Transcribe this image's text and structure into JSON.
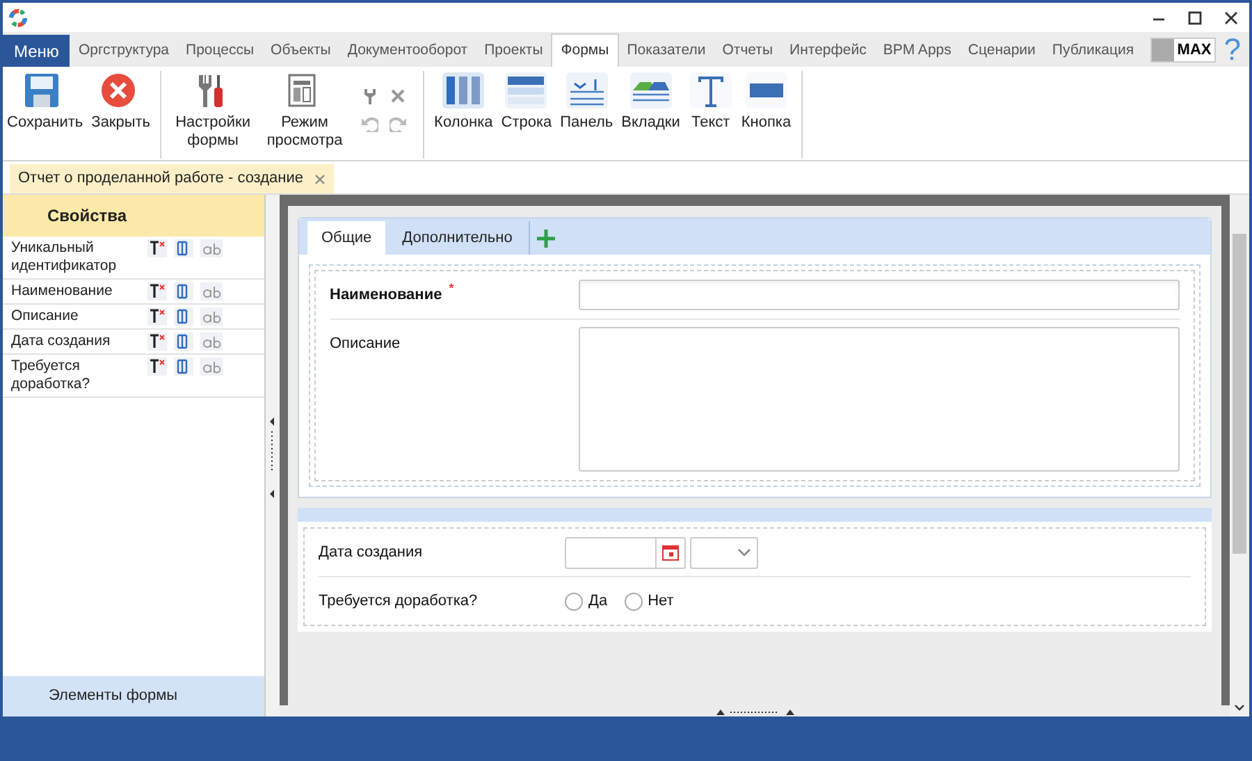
{
  "menu_button": "Меню",
  "tabs": [
    {
      "label": "Оргструктура",
      "selected": false
    },
    {
      "label": "Процессы",
      "selected": false
    },
    {
      "label": "Объекты",
      "selected": false
    },
    {
      "label": "Документооборот",
      "selected": false
    },
    {
      "label": "Проекты",
      "selected": false
    },
    {
      "label": "Формы",
      "selected": true
    },
    {
      "label": "Показатели",
      "selected": false
    },
    {
      "label": "Отчеты",
      "selected": false
    },
    {
      "label": "Интерфейс",
      "selected": false
    },
    {
      "label": "BPM Apps",
      "selected": false
    },
    {
      "label": "Сценарии",
      "selected": false
    },
    {
      "label": "Публикация",
      "selected": false
    }
  ],
  "mode_toggle": "MAX",
  "help": "?",
  "ribbon": [
    {
      "buttons": [
        {
          "kind": "save",
          "label": "Сохранить"
        },
        {
          "kind": "close",
          "label": "Закрыть"
        }
      ]
    },
    {
      "buttons": [
        {
          "kind": "settings",
          "label": "Настройки формы"
        },
        {
          "kind": "preview",
          "label": "Режим просмотра"
        }
      ]
    },
    {
      "buttons": [
        {
          "kind": "column",
          "label": "Колонка"
        },
        {
          "kind": "row",
          "label": "Строка"
        },
        {
          "kind": "panel",
          "label": "Панель"
        },
        {
          "kind": "tabs",
          "label": "Вкладки"
        },
        {
          "kind": "text",
          "label": "Текст"
        },
        {
          "kind": "button",
          "label": "Кнопка"
        }
      ]
    }
  ],
  "document_tab": "Отчет о проделанной работе - создание",
  "properties": {
    "title": "Свойства",
    "items": [
      {
        "label": "Уникальный идентификатор"
      },
      {
        "label": "Наименование"
      },
      {
        "label": "Описание"
      },
      {
        "label": "Дата создания"
      },
      {
        "label": "Требуется доработка?"
      }
    ],
    "footer": "Элементы формы"
  },
  "form": {
    "tabs": [
      {
        "label": "Общие",
        "selected": true
      },
      {
        "label": "Дополнительно",
        "selected": false
      }
    ],
    "name_field": {
      "label": "Наименование",
      "required_mark": "*"
    },
    "description_field": {
      "label": "Описание"
    },
    "date_field": {
      "label": "Дата создания"
    },
    "radio_field": {
      "label": "Требуется доработка?",
      "options": [
        {
          "label": "Да",
          "selected": false
        },
        {
          "label": "Нет",
          "selected": false
        }
      ]
    }
  }
}
